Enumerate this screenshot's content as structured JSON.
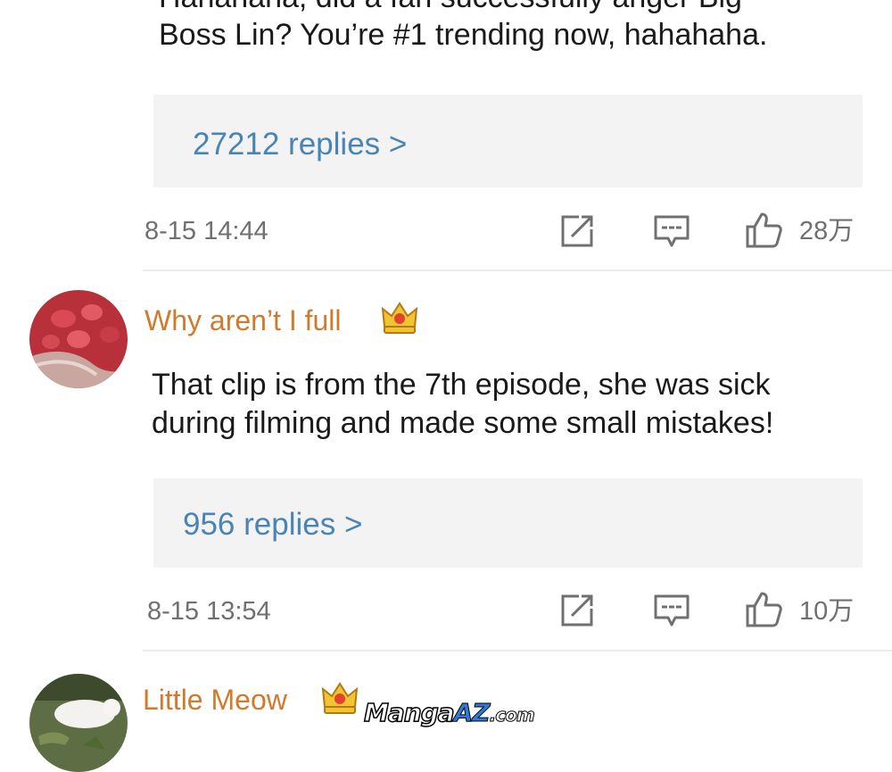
{
  "comments": [
    {
      "text_line1": "Hahahaha, did a fan successfully anger Big",
      "text_line2": "Boss Lin? You’re #1 trending now, hahahaha.",
      "replies": "27212 replies >",
      "date": "8-15",
      "time": "14:44",
      "likes": "28万"
    },
    {
      "username": "Why aren’t I full",
      "text_line1": "That clip is from the 7th episode, she was sick",
      "text_line2": "during filming and made some small mistakes!",
      "replies": "956 replies >",
      "date": "8-15",
      "time": "13:54",
      "likes": "10万"
    },
    {
      "username": "Little Meow"
    }
  ],
  "watermark": {
    "brand": "Manga",
    "accent": "AZ",
    "suffix": ".com"
  },
  "colors": {
    "username": "#d27a2c",
    "link": "#4a84b4",
    "meta": "#707070",
    "reply_box": "#f3f3f3"
  },
  "icons": [
    "share-icon",
    "comment-icon",
    "thumbs-up-icon",
    "crown-badge-icon"
  ]
}
